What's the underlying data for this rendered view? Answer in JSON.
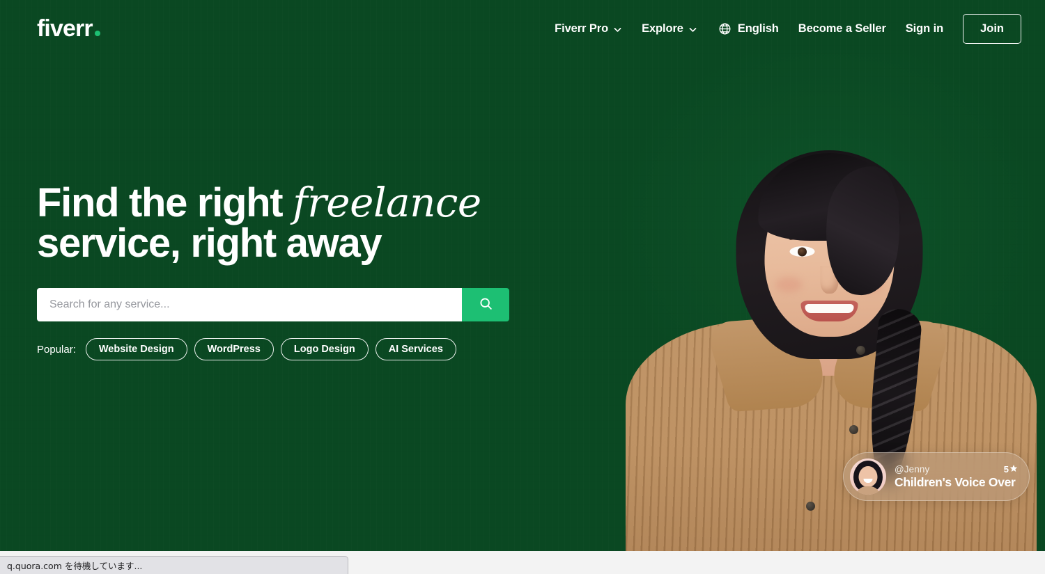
{
  "brand": {
    "logo_text": "fiverr",
    "logo_dot_icon": "dot-icon",
    "accent_green": "#1dbf73",
    "hero_green": "#0a4822"
  },
  "nav": {
    "items": [
      {
        "label": "Fiverr Pro",
        "icon": "chevron-down-icon",
        "has_chevron": true
      },
      {
        "label": "Explore",
        "icon": "chevron-down-icon",
        "has_chevron": true
      }
    ],
    "language": {
      "label": "English",
      "icon": "globe-icon"
    },
    "become_seller_label": "Become a Seller",
    "sign_in_label": "Sign in",
    "join_label": "Join"
  },
  "hero": {
    "headline_line1_a": "Find the right ",
    "headline_line1_em": "freelance",
    "headline_line2": "service, right away",
    "search": {
      "placeholder": "Search for any service...",
      "value": "",
      "button_icon": "search-icon"
    },
    "popular": {
      "label": "Popular:",
      "tags": [
        "Website Design",
        "WordPress",
        "Logo Design",
        "AI Services"
      ]
    },
    "model_image_alt": "smiling-woman-portrait"
  },
  "gig_card": {
    "username": "@Jenny",
    "rating": "5",
    "rating_icon": "star-icon",
    "title": "Children's Voice Over",
    "avatar_icon": "avatar"
  },
  "browser": {
    "status_text": "q.quora.com を待機しています..."
  }
}
